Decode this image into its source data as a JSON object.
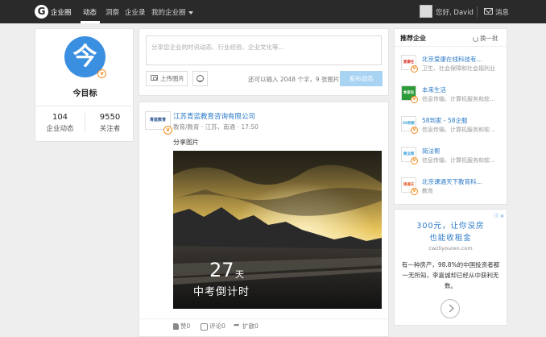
{
  "topnav": {
    "logo_glyph": "G",
    "brand": "企业圈",
    "items": [
      {
        "label": "动态"
      },
      {
        "label": "洞察"
      },
      {
        "label": "企业录"
      },
      {
        "label": "我的企业圈"
      }
    ],
    "greeting": "您好, David",
    "messages": "消息"
  },
  "profile": {
    "logo_glyph": "今",
    "name": "今目标",
    "stats": [
      {
        "value": "104",
        "label": "企业动态"
      },
      {
        "value": "9550",
        "label": "关注者"
      }
    ]
  },
  "composer": {
    "placeholder": "分享您企业的时讯动态、行业经验、企业文化等...",
    "upload_label": "上传图片",
    "remaining": "还可以输入 2048 个字，9 张图片",
    "post_label": "发布动态"
  },
  "post": {
    "author_logo_text": "青蓝教育",
    "author": "江苏青蓝教育咨询有限公司",
    "meta": "教育/教育 · 江苏，南通 · 17:50",
    "text": "分享图片",
    "countdown_num": "27",
    "countdown_unit": "天",
    "countdown_text": "中考倒计时",
    "actions": [
      {
        "label": "赞0"
      },
      {
        "label": "评论0"
      },
      {
        "label": "扩散0"
      }
    ]
  },
  "recommend": {
    "title": "推荐企业",
    "refresh": "换一批",
    "items": [
      {
        "name": "北京爱康在线科技有...",
        "desc": "卫生、社会保障和社会福利业",
        "logo": "爱康在线",
        "color": "#d9342b"
      },
      {
        "name": "本来生活",
        "desc": "信息传输、计算机服务和软...",
        "logo": "本来生活",
        "color": "#2e9b3a"
      },
      {
        "name": "58到家 - 58企服",
        "desc": "信息传输、计算机服务和软...",
        "logo": "58到家",
        "color": "#3aa0d8"
      },
      {
        "name": "简法帮",
        "desc": "信息传输、计算机服务和软...",
        "logo": "简法帮",
        "color": "#3aa0d8"
      },
      {
        "name": "北京课通天下教育科...",
        "desc": "教育",
        "logo": "课通天下",
        "color": "#e35d2a"
      }
    ]
  },
  "ad": {
    "close": "ⓘ ✕",
    "line1": "300元，让你没房",
    "line2": "也能收租金",
    "url": "cwzliyouren.com",
    "body": "有一种房产，98.8%的中国投资者都一无所知，李嘉诚却已经从中获利无数。"
  }
}
